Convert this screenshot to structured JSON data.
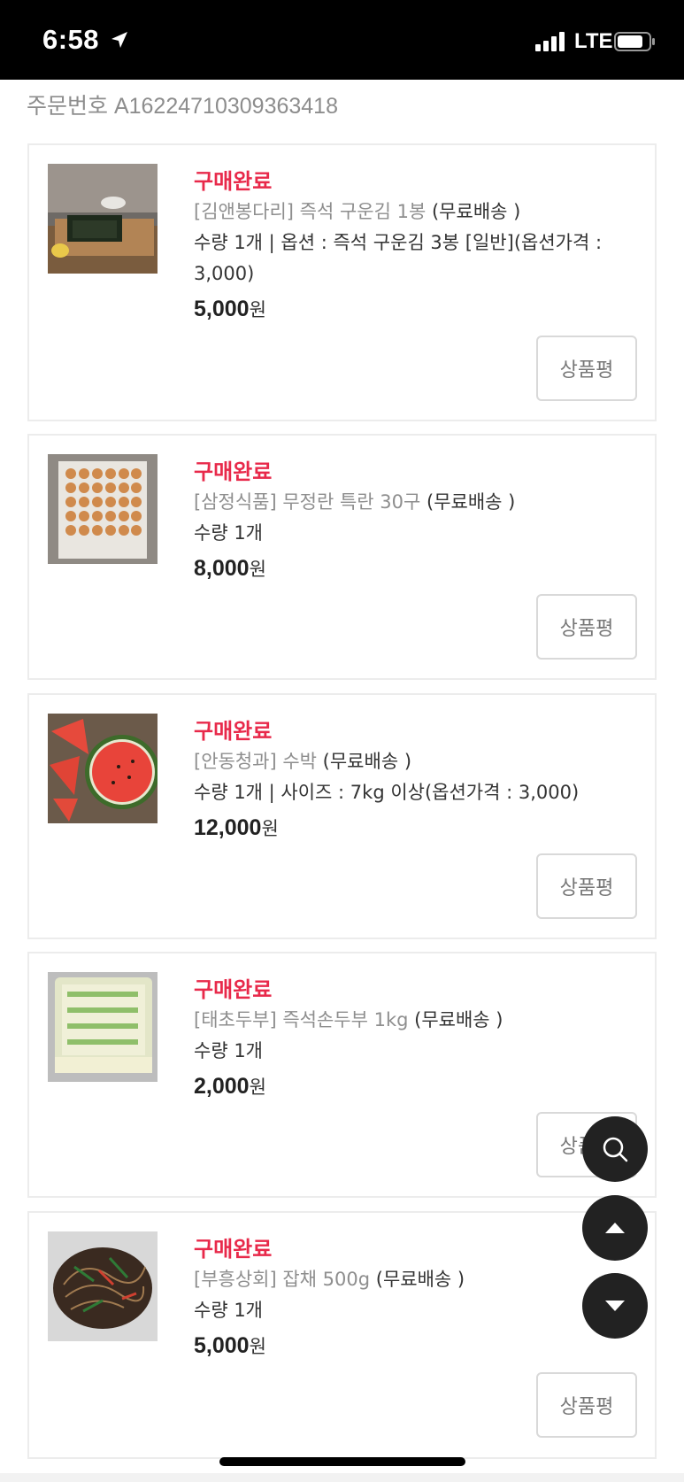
{
  "status_bar": {
    "time": "6:58",
    "network": "LTE"
  },
  "order": {
    "number_text": "주문번호 A16224710309363418"
  },
  "orders": [
    {
      "status": "구매완료",
      "brand_title": "[김앤봉다리] 즉석 구운김 1봉",
      "shipping": "(무료배송 )",
      "detail_1": "수량 1개  | 옵션 : 즉석 구운김 3봉 [일반](옵션가격 :",
      "detail_2": "3,000)",
      "price": "5,000",
      "currency": "원",
      "review_label": "상품평"
    },
    {
      "status": "구매완료",
      "brand_title": "[삼정식품] 무정란 특란 30구",
      "shipping": "(무료배송 )",
      "detail_1": "수량 1개",
      "price": "8,000",
      "currency": "원",
      "review_label": "상품평"
    },
    {
      "status": "구매완료",
      "brand_title": "[안동청과] 수박",
      "shipping": "(무료배송 )",
      "detail_1": "수량 1개  | 사이즈 : 7kg 이상(옵션가격 : 3,000)",
      "price": "12,000",
      "currency": "원",
      "review_label": "상품평"
    },
    {
      "status": "구매완료",
      "brand_title": "[태초두부] 즉석손두부 1kg",
      "shipping": "(무료배송 )",
      "detail_1": "수량 1개",
      "price": "2,000",
      "currency": "원",
      "review_label": "상품평"
    },
    {
      "status": "구매완료",
      "brand_title": "[부흥상회] 잡채 500g",
      "shipping": "(무료배송 )",
      "detail_1": "수량 1개",
      "price": "5,000",
      "currency": "원",
      "review_label": "상품평"
    }
  ],
  "floating_buttons": [
    "search-icon",
    "arrow-up-icon",
    "arrow-down-icon"
  ],
  "colors": {
    "status_accent": "#e8294a",
    "fab_bg": "#222222"
  }
}
